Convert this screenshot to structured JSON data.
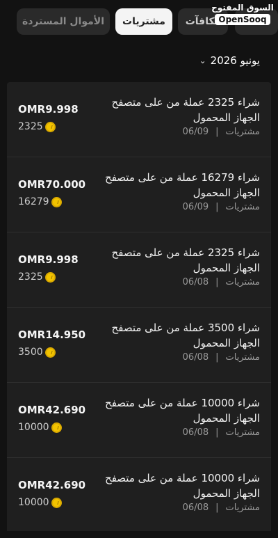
{
  "tabs": {
    "refunded": "الأموال المستردة",
    "purchases": "مشتريات",
    "rewards": "مكافآت"
  },
  "logo": {
    "arabic": "السوق المفتوح",
    "english": "OpenSooq"
  },
  "month_selector": {
    "label": "يونيو 2026"
  },
  "transactions": [
    {
      "title": "شراء 2325 عملة من على متصفح الجهاز المحمول",
      "date": "06/09",
      "category": "مشتريات",
      "price": "OMR9.998",
      "coins": "2325"
    },
    {
      "title": "شراء 16279 عملة من على متصفح الجهاز المحمول",
      "date": "06/09",
      "category": "مشتريات",
      "price": "OMR70.000",
      "coins": "16279"
    },
    {
      "title": "شراء 2325 عملة من على متصفح الجهاز المحمول",
      "date": "06/08",
      "category": "مشتريات",
      "price": "OMR9.998",
      "coins": "2325"
    },
    {
      "title": "شراء 3500 عملة من على متصفح الجهاز المحمول",
      "date": "06/08",
      "category": "مشتريات",
      "price": "OMR14.950",
      "coins": "3500"
    },
    {
      "title": "شراء 10000 عملة من على متصفح الجهاز المحمول",
      "date": "06/08",
      "category": "مشتريات",
      "price": "OMR42.690",
      "coins": "10000"
    },
    {
      "title": "شراء 10000 عملة من على متصفح الجهاز المحمول",
      "date": "06/08",
      "category": "مشتريات",
      "price": "OMR42.690",
      "coins": "10000"
    }
  ],
  "colors": {
    "background": "#121212",
    "card": "#1f1f1f",
    "active_tab": "#f4f4f4",
    "coin": "#f2c300"
  }
}
